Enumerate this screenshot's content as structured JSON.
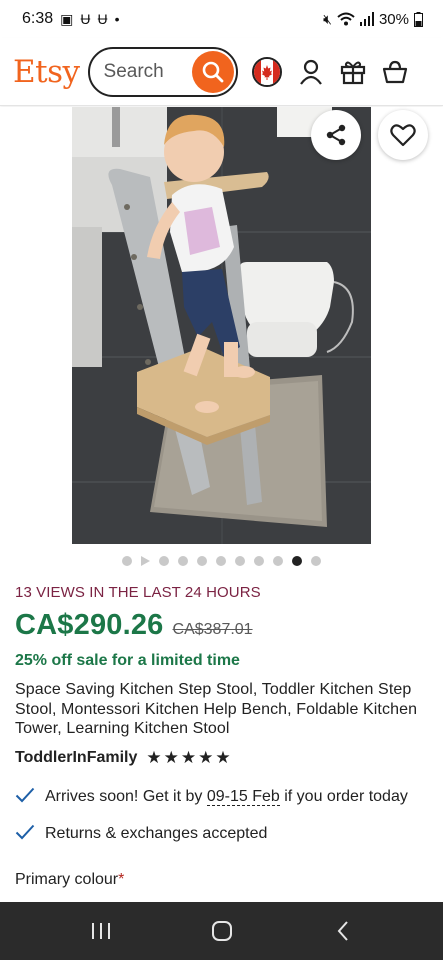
{
  "status_bar": {
    "time": "6:38",
    "battery": "30%"
  },
  "header": {
    "logo": "Etsy",
    "search_placeholder": "Search"
  },
  "gallery": {
    "dots_total": 11,
    "active_dot_index": 9
  },
  "product": {
    "views_notice": "13 VIEWS IN THE LAST 24 HOURS",
    "price": "CA$290.26",
    "original_price": "CA$387.01",
    "sale_notice": "25% off sale for a limited time",
    "title": "Space Saving Kitchen Step Stool, Toddler Kitchen Step Stool, Montessori Kitchen Help Bench, Foldable Kitchen Tower, Learning Kitchen Stool",
    "shop_name": "ToddlerInFamily",
    "rating_stars": 5,
    "arrival_prefix": "Arrives soon! Get it by ",
    "arrival_date": "09-15 Feb",
    "arrival_suffix": " if you order today",
    "returns": "Returns & exchanges accepted",
    "primary_colour_label": "Primary colour",
    "required_marker": "*"
  },
  "colors": {
    "etsy_orange": "#f1641e",
    "price_green": "#1c7748",
    "views_maroon": "#7b2343"
  }
}
